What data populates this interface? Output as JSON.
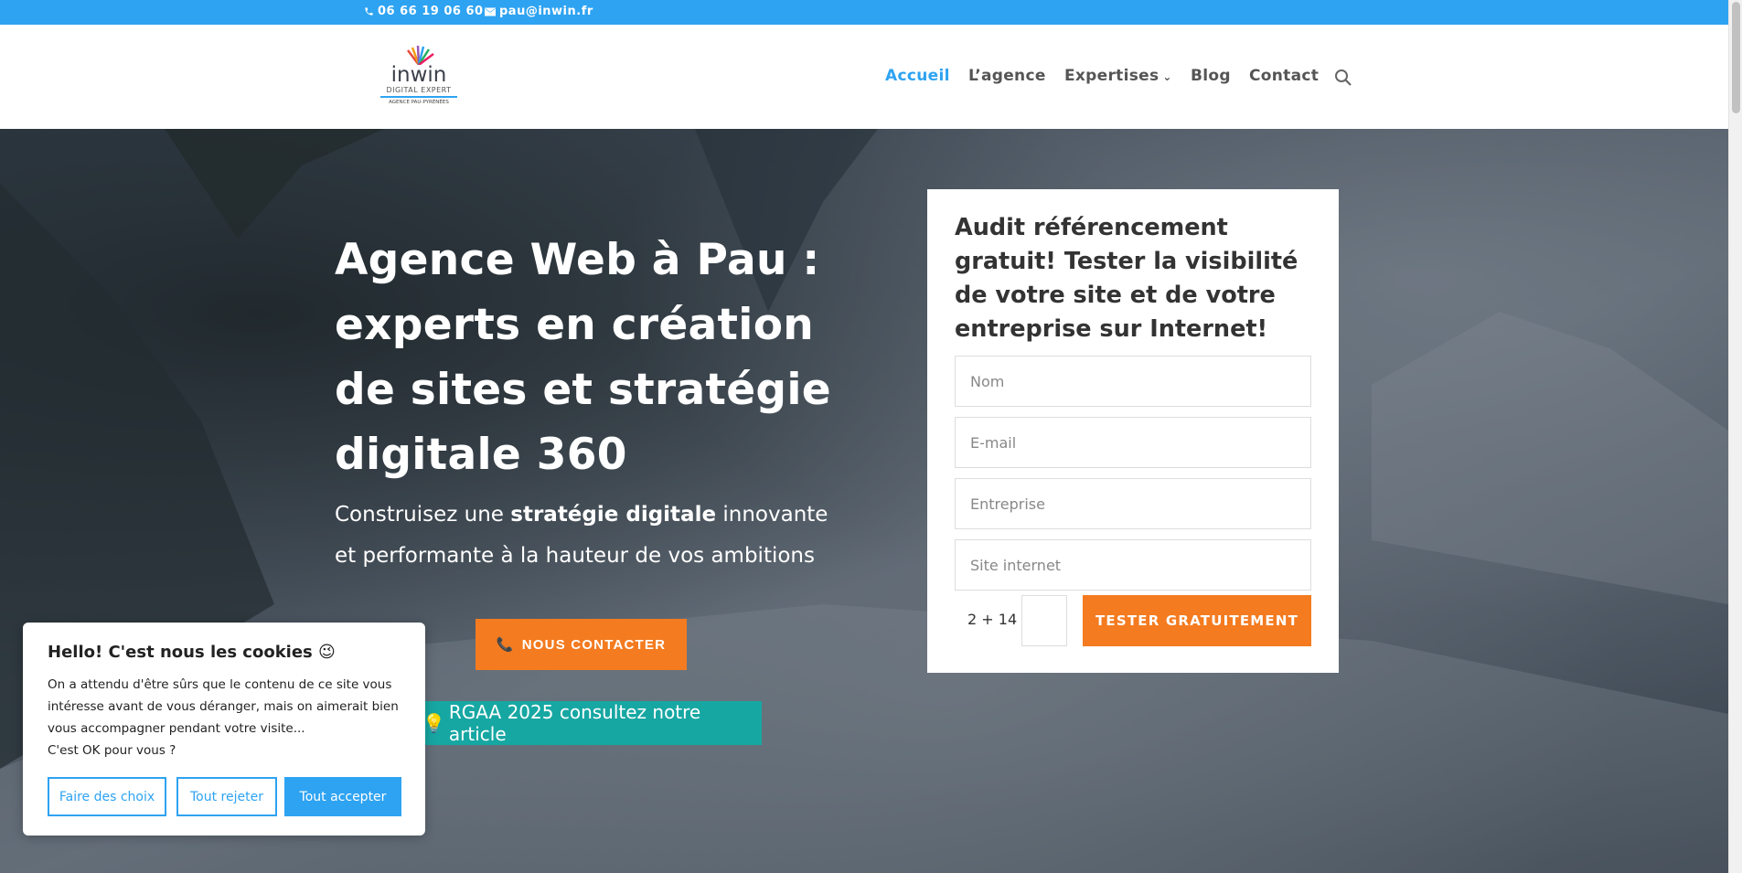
{
  "topbar": {
    "phone": "06 66 19 06 60",
    "email": "pau@inwin.fr",
    "bg_color": "#2ea3f2"
  },
  "logo": {
    "brand": "inwin",
    "tagline": "DIGITAL EXPERT",
    "sub": "AGENCE PAU-PYRÉNÉES"
  },
  "nav": {
    "items": [
      {
        "label": "Accueil",
        "active": true
      },
      {
        "label": "L’agence"
      },
      {
        "label": "Expertises"
      },
      {
        "label": "Blog"
      },
      {
        "label": "Contact"
      }
    ],
    "search_icon": "search-icon"
  },
  "hero": {
    "title": "Agence Web à Pau : experts en création de sites et stratégie digitale 360",
    "sub_before": "Construisez une ",
    "sub_bold": "stratégie digitale",
    "sub_after": " innovante et performante à la hauteur de vos ambitions",
    "contact_button": "NOUS CONTACTER",
    "rgaa_button": "RGAA 2025 consultez notre article",
    "accent_orange": "#f47b20",
    "accent_teal": "#17a7a3"
  },
  "audit": {
    "heading": "Audit référencement gratuit! Tester la visibilité de votre site et de votre entreprise sur Internet!",
    "fields": [
      {
        "placeholder": "Nom"
      },
      {
        "placeholder": "E-mail"
      },
      {
        "placeholder": "Entreprise"
      },
      {
        "placeholder": "Site internet"
      }
    ],
    "captcha": "2 + 14 =",
    "submit": "TESTER GRATUITEMENT"
  },
  "cookie": {
    "title": "Hello! C'est nous les cookies 😉",
    "text_1": "On a attendu d'être sûrs que le contenu de ce site vous intéresse avant de vous déranger, mais on aimerait bien vous accompagner pendant votre visite...",
    "text_2": "C'est OK pour vous ?",
    "btn_choices": "Faire des choix",
    "btn_reject": "Tout rejeter",
    "btn_accept": "Tout accepter"
  }
}
